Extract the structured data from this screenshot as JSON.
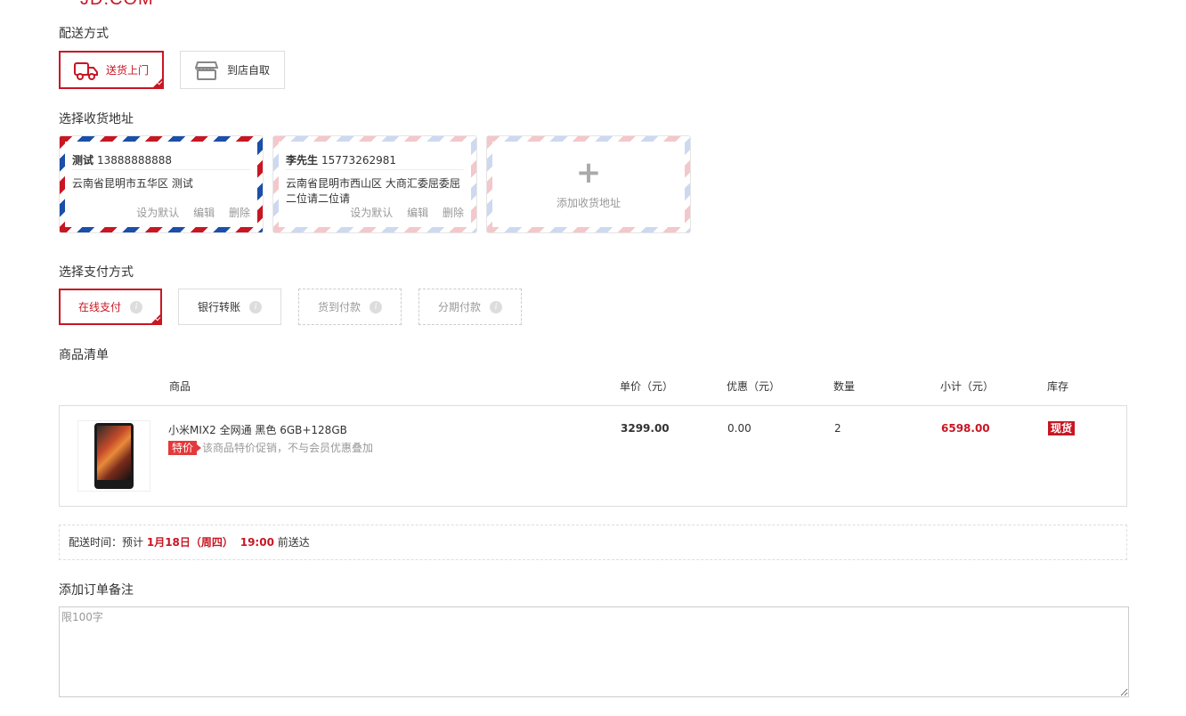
{
  "header": {
    "logo_text": "JD.COM"
  },
  "delivery_method": {
    "title": "配送方式",
    "options": [
      {
        "label": "送货上门",
        "selected": true
      },
      {
        "label": "到店自取",
        "selected": false
      }
    ]
  },
  "address": {
    "title": "选择收货地址",
    "cards": [
      {
        "name": "测试",
        "phone": "13888888888",
        "detail": "云南省昆明市五华区 测试",
        "set_default": "设为默认",
        "edit": "编辑",
        "delete": "删除"
      },
      {
        "name": "李先生",
        "phone": "15773262981",
        "detail": "云南省昆明市西山区 大商汇委屈委屈二位请二位请",
        "set_default": "设为默认",
        "edit": "编辑",
        "delete": "删除"
      }
    ],
    "add_label": "添加收货地址"
  },
  "payment": {
    "title": "选择支付方式",
    "options": [
      {
        "label": "在线支付"
      },
      {
        "label": "银行转账"
      },
      {
        "label": "货到付款"
      },
      {
        "label": "分期付款"
      }
    ],
    "info_glyph": "i"
  },
  "goods": {
    "title": "商品清单",
    "headers": {
      "product": "商品",
      "price": "单价（元）",
      "discount": "优惠（元）",
      "quantity": "数量",
      "subtotal": "小计（元）",
      "stock": "库存"
    },
    "item": {
      "name": "小米MIX2 全网通 黑色 6GB+128GB",
      "tag": "特价",
      "promo_note": "该商品特价促销，不与会员优惠叠加",
      "price": "3299.00",
      "discount": "0.00",
      "quantity": "2",
      "subtotal": "6598.00",
      "stock": "现货"
    }
  },
  "delivery_time": {
    "prefix": "配送时间：预计",
    "date": "1月18日（周四）",
    "time": "19:00",
    "suffix": "前送达"
  },
  "remark": {
    "title": "添加订单备注",
    "placeholder": "限100字",
    "value": ""
  },
  "colors": {
    "accent": "#c81623",
    "airmail_blue": "#1b4fa8",
    "special_tag": "#e4393c"
  }
}
